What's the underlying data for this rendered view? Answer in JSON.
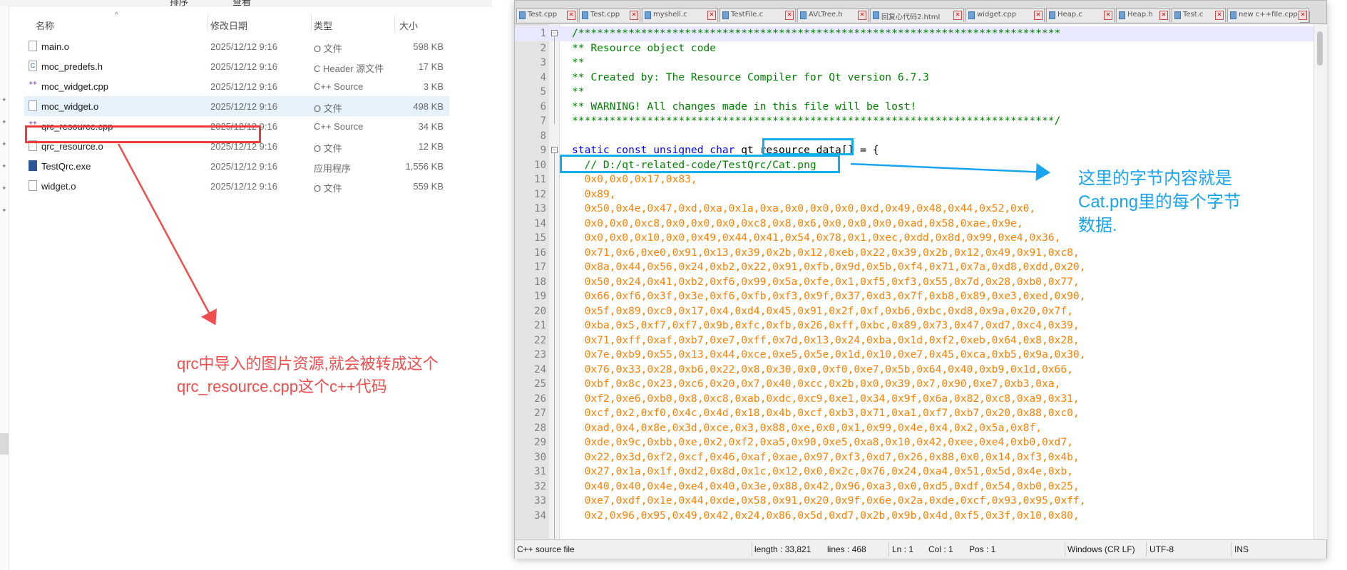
{
  "explorer": {
    "toolbar": {
      "sort_label": "排序",
      "view_label": "查看"
    },
    "columns": {
      "name": "名称",
      "date": "修改日期",
      "type": "类型",
      "size": "大小"
    },
    "files": [
      {
        "name": "main.o",
        "date": "2025/12/12 9:16",
        "type": "O 文件",
        "size": "598 KB",
        "icon": "file-icon"
      },
      {
        "name": "moc_predefs.h",
        "date": "2025/12/12 9:16",
        "type": "C Header 源文件",
        "size": "17 KB",
        "icon": "header-file-icon"
      },
      {
        "name": "moc_widget.cpp",
        "date": "2025/12/12 9:16",
        "type": "C++ Source",
        "size": "3 KB",
        "icon": "cpp-file-icon"
      },
      {
        "name": "moc_widget.o",
        "date": "2025/12/12 9:16",
        "type": "O 文件",
        "size": "498 KB",
        "icon": "file-icon",
        "selected": true
      },
      {
        "name": "qrc_resource.cpp",
        "date": "2025/12/12 9:16",
        "type": "C++ Source",
        "size": "34 KB",
        "icon": "cpp-file-icon"
      },
      {
        "name": "qrc_resource.o",
        "date": "2025/12/12 9:16",
        "type": "O 文件",
        "size": "12 KB",
        "icon": "file-icon"
      },
      {
        "name": "TestQrc.exe",
        "date": "2025/12/12 9:16",
        "type": "应用程序",
        "size": "1,556 KB",
        "icon": "exe-icon"
      },
      {
        "name": "widget.o",
        "date": "2025/12/12 9:16",
        "type": "O 文件",
        "size": "559 KB",
        "icon": "file-icon"
      }
    ]
  },
  "annotations": {
    "red_note": "qrc中导入的图片资源,就会被转成这个\nqrc_resource.cpp这个c++代码",
    "blue_note": "这里的字节内容就是\nCat.png里的每个字节\n数据.",
    "red_color": "#f04e4e",
    "blue_color": "#19a4f1"
  },
  "editor": {
    "tabs": [
      "Test.cpp",
      "Test.cpp",
      "myshell.c",
      "TestFile.c",
      "AVLTree.h",
      "回复心代码2.html",
      "widget.cpp",
      "Heap.c",
      "Heap.h",
      "Test.c",
      "new c++file.cpp"
    ],
    "lines": [
      {
        "n": "1",
        "t": "c-com",
        "s": "/*****************************************************************************"
      },
      {
        "n": "2",
        "t": "c-com",
        "s": "** Resource object code"
      },
      {
        "n": "3",
        "t": "c-com",
        "s": "**"
      },
      {
        "n": "4",
        "t": "c-com",
        "s": "** Created by: The Resource Compiler for Qt version 6.7.3"
      },
      {
        "n": "5",
        "t": "c-com",
        "s": "**"
      },
      {
        "n": "6",
        "t": "c-com",
        "s": "** WARNING! All changes made in this file will be lost!"
      },
      {
        "n": "7",
        "t": "c-com",
        "s": "*****************************************************************************/"
      },
      {
        "n": "8",
        "t": "c-txt",
        "s": ""
      },
      {
        "n": "9",
        "t": "decl",
        "s": "static const unsigned char qt_resource_data[] = {"
      },
      {
        "n": "10",
        "t": "c-com",
        "s": "  // D:/qt-related-code/TestQrc/Cat.png"
      },
      {
        "n": "11",
        "t": "c-num",
        "s": "  0x0,0x0,0x17,0x83,"
      },
      {
        "n": "12",
        "t": "c-num",
        "s": "  0x89,"
      },
      {
        "n": "13",
        "t": "c-num",
        "s": "  0x50,0x4e,0x47,0xd,0xa,0x1a,0xa,0x0,0x0,0x0,0xd,0x49,0x48,0x44,0x52,0x0,"
      },
      {
        "n": "14",
        "t": "c-num",
        "s": "  0x0,0x0,0xc8,0x0,0x0,0x0,0xc8,0x8,0x6,0x0,0x0,0x0,0xad,0x58,0xae,0x9e,"
      },
      {
        "n": "15",
        "t": "c-num",
        "s": "  0x0,0x0,0x10,0x0,0x49,0x44,0x41,0x54,0x78,0x1,0xec,0xdd,0x8d,0x99,0xe4,0x36,"
      },
      {
        "n": "16",
        "t": "c-num",
        "s": "  0x71,0x6,0xe0,0x91,0x13,0x39,0x2b,0x12,0xeb,0x22,0x39,0x2b,0x12,0x49,0x91,0xc8,"
      },
      {
        "n": "17",
        "t": "c-num",
        "s": "  0x8a,0x44,0x56,0x24,0xb2,0x22,0x91,0xfb,0x9d,0x5b,0xf4,0x71,0x7a,0xd8,0xdd,0x20,"
      },
      {
        "n": "18",
        "t": "c-num",
        "s": "  0x50,0x24,0x41,0xb2,0xf6,0x99,0x5a,0xfe,0x1,0xf5,0xf3,0x55,0x7d,0x28,0xb0,0x77,"
      },
      {
        "n": "19",
        "t": "c-num",
        "s": "  0x66,0xf6,0x3f,0x3e,0xf6,0xfb,0xf3,0x9f,0x37,0xd3,0x7f,0xb8,0x89,0xe3,0xed,0x90,"
      },
      {
        "n": "20",
        "t": "c-num",
        "s": "  0x5f,0x89,0xc0,0x17,0x4,0xd4,0x45,0x91,0x2f,0xf,0xb6,0xbc,0xd8,0x9a,0x20,0x7f,"
      },
      {
        "n": "21",
        "t": "c-num",
        "s": "  0xba,0x5,0xf7,0xf7,0x9b,0xfc,0xfb,0x26,0xff,0xbc,0x89,0x73,0x47,0xd7,0xc4,0x39,"
      },
      {
        "n": "22",
        "t": "c-num",
        "s": "  0x71,0xff,0xaf,0xb7,0xe7,0xff,0x7d,0x13,0x24,0xba,0x1d,0xf2,0xeb,0x64,0x8,0x28,"
      },
      {
        "n": "23",
        "t": "c-num",
        "s": "  0x7e,0xb9,0x55,0x13,0x44,0xce,0xe5,0x5e,0x1d,0x10,0xe7,0x45,0xca,0xb5,0x9a,0x30,"
      },
      {
        "n": "24",
        "t": "c-num",
        "s": "  0x76,0x33,0x28,0xb6,0x22,0x8,0x30,0x0,0xf0,0xe7,0x5b,0x64,0x40,0xb9,0x1d,0x66,"
      },
      {
        "n": "25",
        "t": "c-num",
        "s": "  0xbf,0x8c,0x23,0xc6,0x20,0x7,0x40,0xcc,0x2b,0x0,0x39,0x7,0x90,0xe7,0xb3,0xa,"
      },
      {
        "n": "26",
        "t": "c-num",
        "s": "  0xf2,0xe6,0xb0,0x8,0xc8,0xab,0xdc,0xc9,0xe1,0x34,0x9f,0x6a,0x82,0xc8,0xa9,0x31,"
      },
      {
        "n": "27",
        "t": "c-num",
        "s": "  0xcf,0x2,0xf0,0x4c,0x4d,0x18,0x4b,0xcf,0xb3,0x71,0xa1,0xf7,0xb7,0x20,0x88,0xc0,"
      },
      {
        "n": "28",
        "t": "c-num",
        "s": "  0xad,0x4,0x8e,0x3d,0xce,0x3,0x88,0xe,0x0,0x1,0x99,0x4e,0x4,0x2,0x5a,0x8f,"
      },
      {
        "n": "29",
        "t": "c-num",
        "s": "  0xde,0x9c,0xbb,0xe,0x2,0xf2,0xa5,0x90,0xe5,0xa8,0x10,0x42,0xee,0xe4,0xb0,0xd7,"
      },
      {
        "n": "30",
        "t": "c-num",
        "s": "  0x22,0x3d,0xf2,0xcf,0x46,0xaf,0xae,0x97,0xf3,0xd7,0x26,0x88,0x0,0x14,0xf3,0x4b,"
      },
      {
        "n": "31",
        "t": "c-num",
        "s": "  0x27,0x1a,0x1f,0xd2,0x8d,0x1c,0x12,0x0,0x2c,0x76,0x24,0xa4,0x51,0x5d,0x4e,0xb,"
      },
      {
        "n": "32",
        "t": "c-num",
        "s": "  0x40,0x40,0x4e,0xe4,0x40,0x3e,0x88,0x42,0x96,0xa3,0x0,0xd5,0xdf,0x54,0xb0,0x25,"
      },
      {
        "n": "33",
        "t": "c-num",
        "s": "  0xe7,0xdf,0x1e,0x44,0xde,0x58,0x91,0x20,0x9f,0x6e,0x2a,0xde,0xcf,0x93,0x95,0xff,"
      },
      {
        "n": "34",
        "t": "c-num",
        "s": "  0x2,0x96,0x95,0x49,0x42,0x24,0x86,0x5d,0xd7,0x2b,0x9b,0x4d,0xf5,0x3f,0x10,0x80,"
      }
    ],
    "declaration": {
      "kw": "static const unsigned char",
      "name": " qt_resource_data[] = {"
    }
  },
  "statusbar": {
    "filetype": "C++ source file",
    "length": "length : 33,821",
    "lines": "lines : 468",
    "ln": "Ln : 1",
    "col": "Col : 1",
    "pos": "Pos : 1",
    "eol": "Windows (CR LF)",
    "encoding": "UTF-8",
    "mode": "INS"
  }
}
